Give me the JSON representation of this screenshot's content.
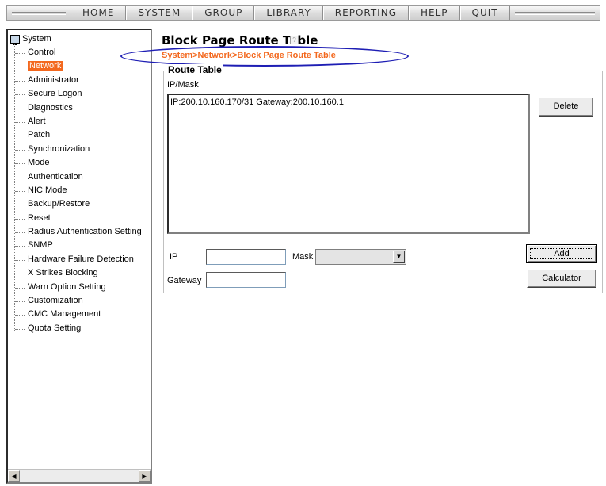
{
  "menu": {
    "items": [
      "HOME",
      "SYSTEM",
      "GROUP",
      "LIBRARY",
      "REPORTING",
      "HELP",
      "QUIT"
    ]
  },
  "tree": {
    "root": "System",
    "items": [
      "Control",
      "Network",
      "Administrator",
      "Secure Logon",
      "Diagnostics",
      "Alert",
      "Patch",
      "Synchronization",
      "Mode",
      "Authentication",
      "NIC Mode",
      "Backup/Restore",
      "Reset",
      "Radius Authentication Setting",
      "SNMP",
      "Hardware Failure Detection",
      "X Strikes Blocking",
      "Warn Option Setting",
      "Customization",
      "CMC Management",
      "Quota Setting"
    ],
    "selected": "Network",
    "scroll_left": "◀",
    "scroll_right": "▶"
  },
  "page": {
    "title": "Block Page Route Table",
    "help_glyph": "?",
    "breadcrumb": "System>Network>Block Page Route Table"
  },
  "route_table": {
    "legend": "Route Table",
    "column_header": "IP/Mask",
    "rows": [
      "IP:200.10.160.170/31 Gateway:200.10.160.1"
    ],
    "delete_label": "Delete"
  },
  "form": {
    "ip_label": "IP",
    "ip_value": "",
    "mask_label": "Mask",
    "mask_value": "",
    "gateway_label": "Gateway",
    "gateway_value": "",
    "add_label": "Add",
    "calculator_label": "Calculator",
    "dropdown_glyph": "▼"
  },
  "colors": {
    "accent_orange": "#f3681e",
    "annotation_blue": "#1e1eb4"
  }
}
